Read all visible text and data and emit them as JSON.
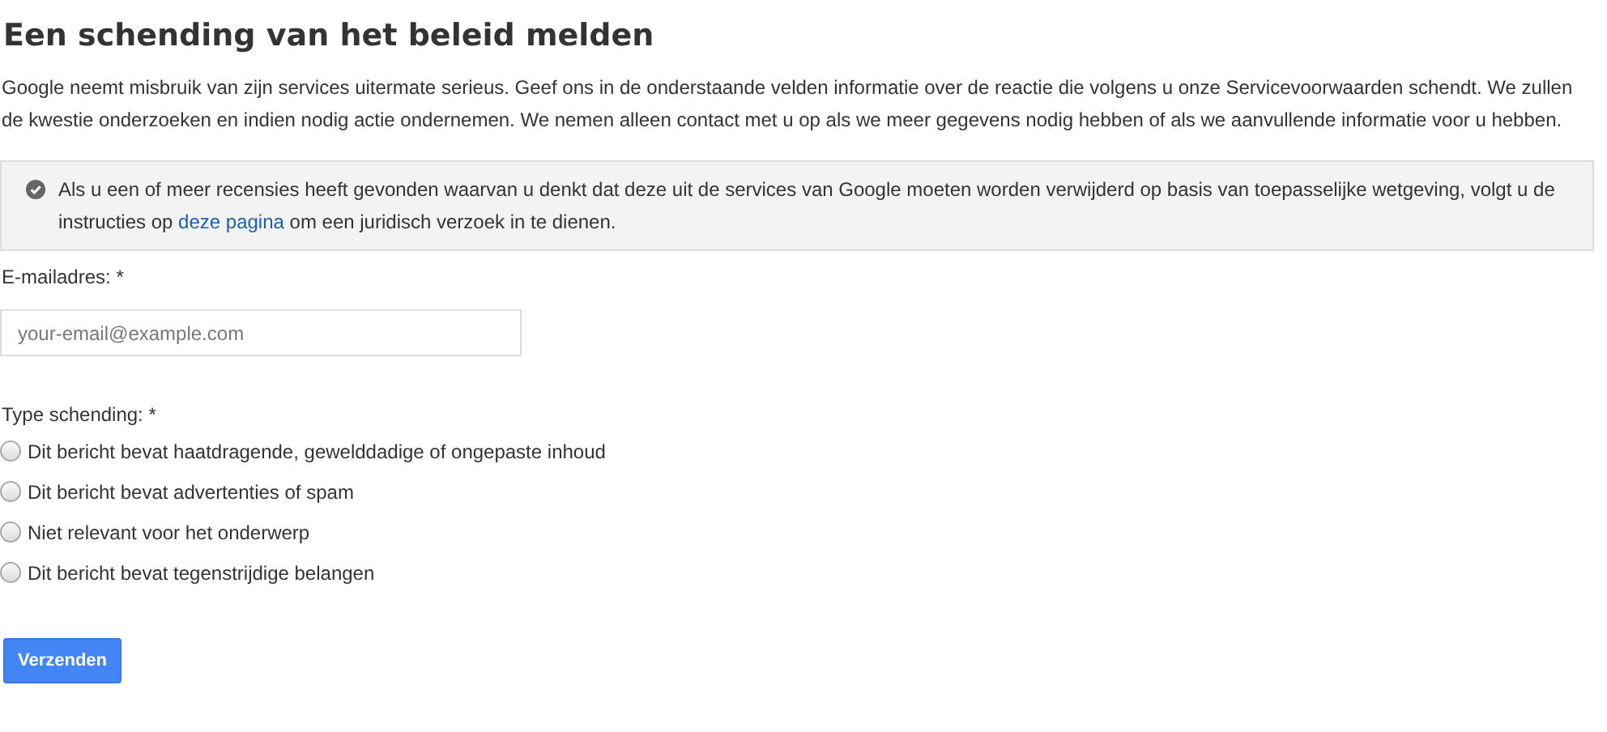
{
  "title": "Een schending van het beleid melden",
  "intro": "Google neemt misbruik van zijn services uitermate serieus. Geef ons in de onderstaande velden informatie over de reactie die volgens u onze Servicevoorwaarden schendt. We zullen de kwestie onderzoeken en indien nodig actie ondernemen. We nemen alleen contact met u op als we meer gegevens nodig hebben of als we aanvullende informatie voor u hebben.",
  "notice": {
    "text_before": "Als u een of meer recensies heeft gevonden waarvan u denkt dat deze uit de services van Google moeten worden verwijderd op basis van toepasselijke wetgeving, volgt u de instructies op",
    "link": "deze pagina",
    "text_after": "om een juridisch verzoek in te dienen."
  },
  "email": {
    "label": "E-mailadres: *",
    "placeholder": "your-email@example.com"
  },
  "violation_type": {
    "label": "Type schending: *",
    "options": [
      {
        "label": "Dit bericht bevat haatdragende, gewelddadige of ongepaste inhoud",
        "selected": false
      },
      {
        "label": "Dit bericht bevat advertenties of spam",
        "selected": false
      },
      {
        "label": "Niet relevant voor het onderwerp",
        "selected": false
      },
      {
        "label": "Dit bericht bevat tegenstrijdige belangen",
        "selected": false
      }
    ]
  },
  "submit": "Verzenden"
}
